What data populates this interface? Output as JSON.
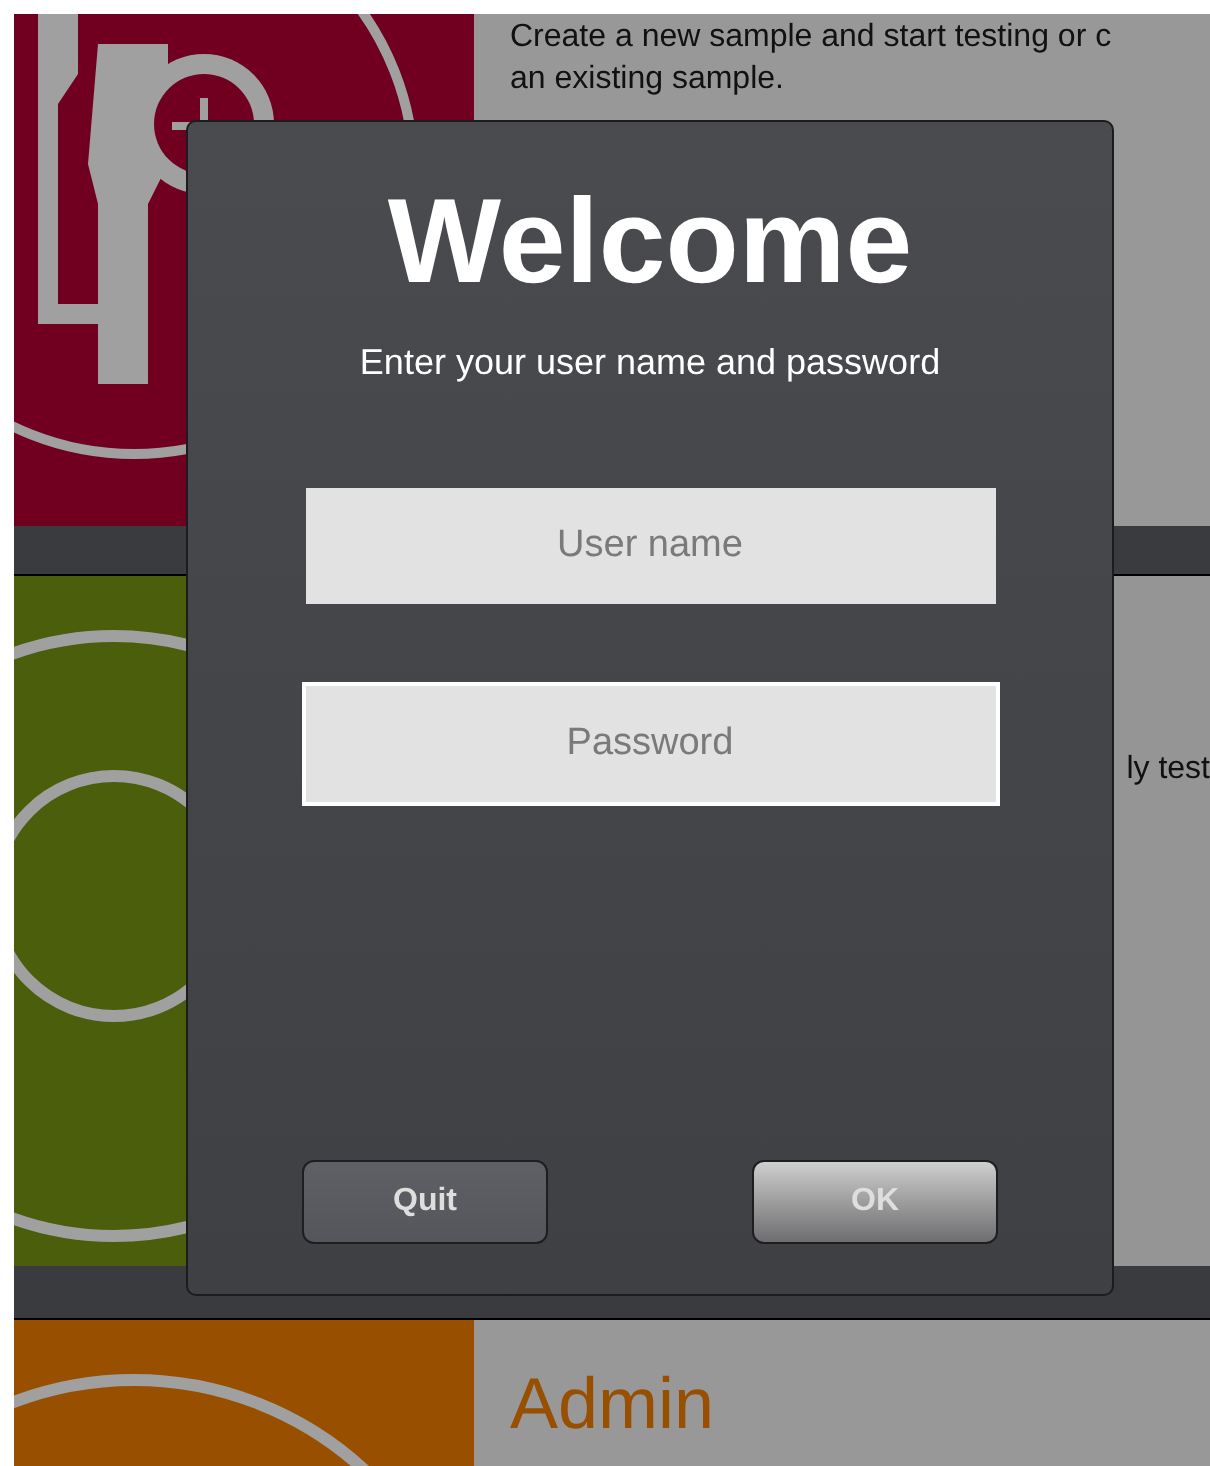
{
  "tiles": [
    {
      "kind": "specimen",
      "color": "#710020",
      "lines": [
        "Create a new sample and start testing or c",
        "an existing sample."
      ]
    },
    {
      "kind": "rings",
      "color": "#4a5e0b",
      "lines": [
        "ly test"
      ]
    },
    {
      "kind": "arc",
      "color": "#985000",
      "heading": "Admin"
    }
  ],
  "dialog": {
    "title": "Welcome",
    "subtitle": "Enter your user name and password",
    "fields": [
      {
        "placeholder": "User name",
        "focused": false
      },
      {
        "placeholder": "Password",
        "focused": true
      }
    ],
    "buttons": [
      {
        "label": "Quit",
        "kind": "secondary"
      },
      {
        "label": "OK",
        "kind": "primary"
      }
    ]
  }
}
